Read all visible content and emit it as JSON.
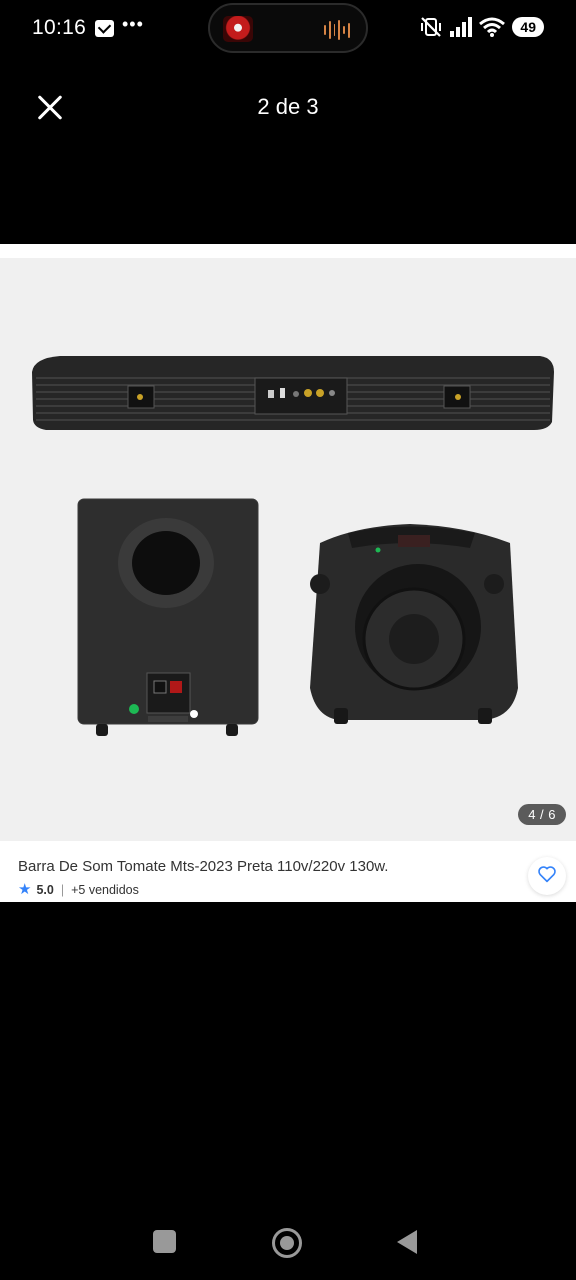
{
  "status_bar": {
    "time": "10:16",
    "more_indicator": "•••",
    "battery": "49",
    "icons": [
      "mail-icon",
      "media-thumbnail",
      "audio-bars-icon",
      "vibrate-off-icon",
      "signal-icon",
      "wifi-icon",
      "battery-icon"
    ]
  },
  "viewer": {
    "title": "2 de 3",
    "close_icon": "close-icon"
  },
  "product": {
    "image_counter": "4 / 6",
    "title": "Barra De Som Tomate Mts-2023 Preta 110v/220v 130w.",
    "rating": "5.0",
    "separator": "|",
    "sold": "+5 vendidos",
    "star_icon": "star-icon",
    "favorite_icon": "heart-icon"
  },
  "nav_bar": {
    "icons": [
      "recents-square-icon",
      "home-circle-icon",
      "back-triangle-icon"
    ]
  },
  "colors": {
    "accent": "#3483fa",
    "background": "#000000",
    "image_bg": "#f0f0f0"
  }
}
